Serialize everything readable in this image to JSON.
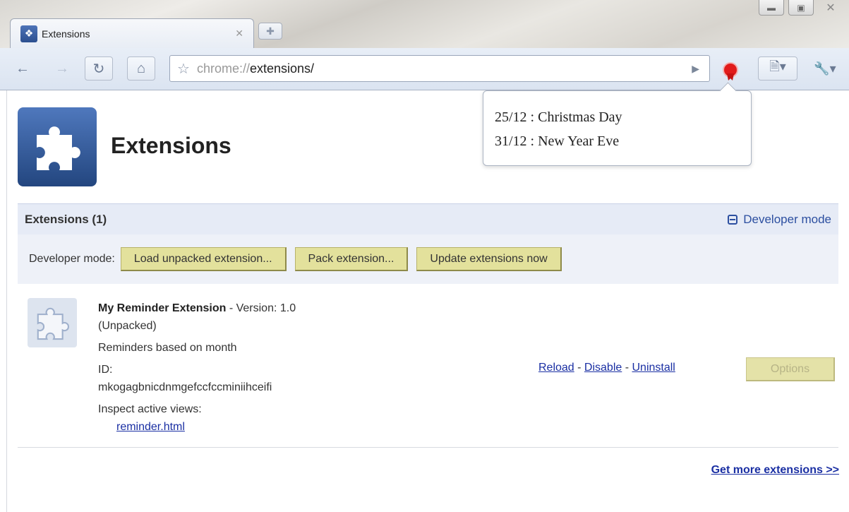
{
  "browser": {
    "tab_title": "Extensions",
    "url_prefix": "chrome://",
    "url_path": "extensions/"
  },
  "popup": {
    "lines": [
      "25/12 : Christmas Day",
      "31/12 : New Year Eve"
    ]
  },
  "page": {
    "title": "Extensions"
  },
  "section": {
    "title": "Extensions (1)",
    "developer_toggle": "Developer mode"
  },
  "developer_bar": {
    "label": "Developer mode:",
    "buttons": [
      "Load unpacked extension...",
      "Pack extension...",
      "Update extensions now"
    ]
  },
  "extension": {
    "name": "My Reminder Extension",
    "version": " - Version: 1.0",
    "unpacked": "(Unpacked)",
    "description": "Reminders based on month",
    "id_label": "ID:",
    "id_value": "mkogagbnicdnmgefccfccminiihceifi",
    "inspect_label": "Inspect active views:",
    "inspect_link": "reminder.html",
    "action_reload": "Reload",
    "action_disable": "Disable",
    "action_uninstall": "Uninstall",
    "separator": " - ",
    "options_label": "Options"
  },
  "footer": {
    "more_link": "Get more extensions >>"
  },
  "colors": {
    "accent_blue": "#1a2fa3",
    "dev_button": "#e3e19c",
    "header_bg": "#e6ebf6",
    "ribbon_red": "#e11b1b"
  }
}
